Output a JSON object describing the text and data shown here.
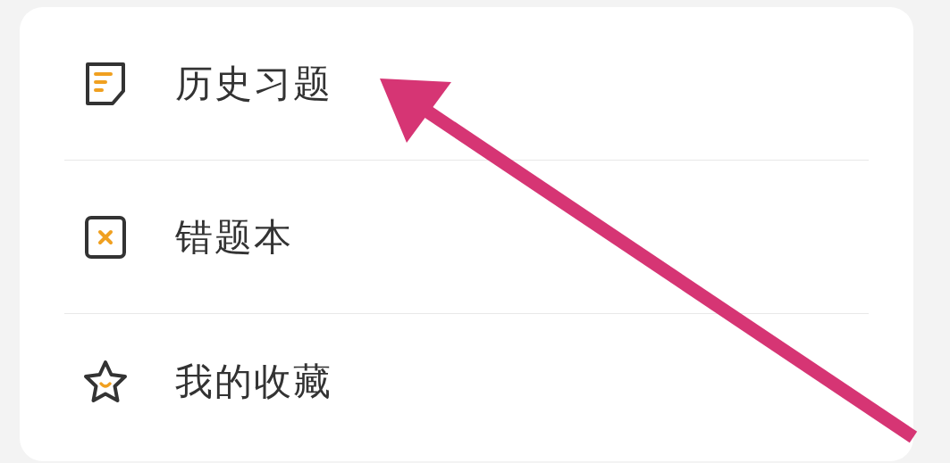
{
  "menu": {
    "items": [
      {
        "kind": "history",
        "label": "历史习题"
      },
      {
        "kind": "mistakes",
        "label": "错题本"
      },
      {
        "kind": "favorites",
        "label": "我的收藏"
      }
    ]
  },
  "annotation": {
    "kind": "arrow"
  }
}
